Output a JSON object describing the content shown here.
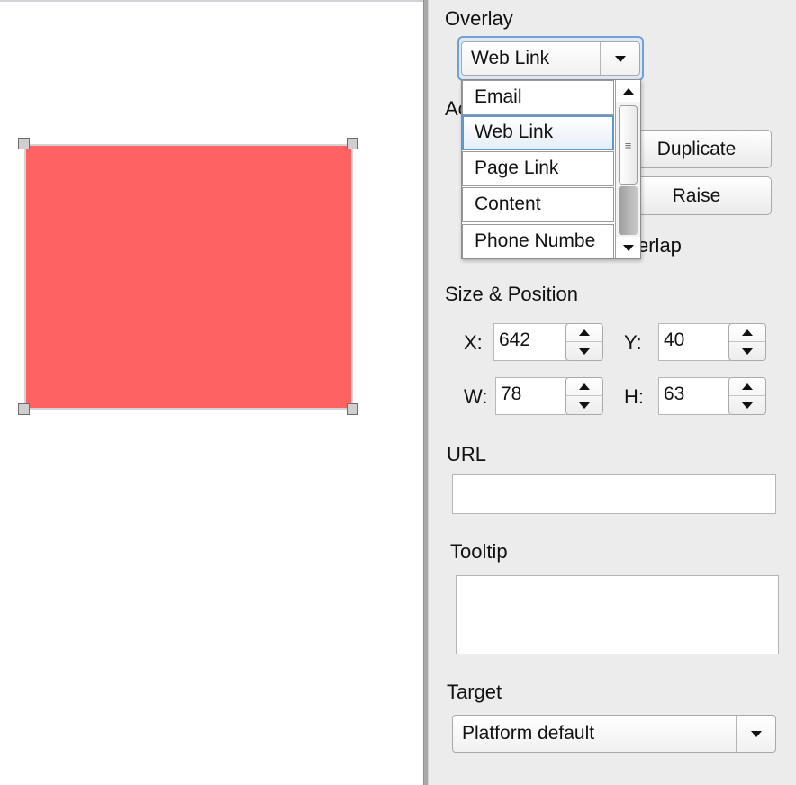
{
  "overlay": {
    "heading": "Overlay",
    "selected": "Web Link",
    "options": [
      "Email",
      "Web Link",
      "Page Link",
      "Content",
      "Phone Numbe"
    ]
  },
  "actions": {
    "heading_partial": "Ac",
    "duplicate_label": "Duplicate",
    "raise_label": "Raise",
    "overlap_partial": "erlap"
  },
  "size_position": {
    "heading": "Size & Position",
    "x_label": "X:",
    "x_value": "642",
    "y_label": "Y:",
    "y_value": "40",
    "w_label": "W:",
    "w_value": "78",
    "h_label": "H:",
    "h_value": "63"
  },
  "url": {
    "label": "URL",
    "value": ""
  },
  "tooltip": {
    "label": "Tooltip",
    "value": ""
  },
  "target": {
    "label": "Target",
    "selected": "Platform default"
  },
  "colors": {
    "overlay_fill": "#ff6262",
    "focus_ring": "#6ea2dc",
    "panel_bg": "#ececec"
  },
  "icons": {
    "dropdown_arrow": "chevron-down-icon",
    "spinner_up": "arrow-up-icon",
    "spinner_down": "arrow-down-icon",
    "scroll_grip": "grip-lines-icon"
  }
}
